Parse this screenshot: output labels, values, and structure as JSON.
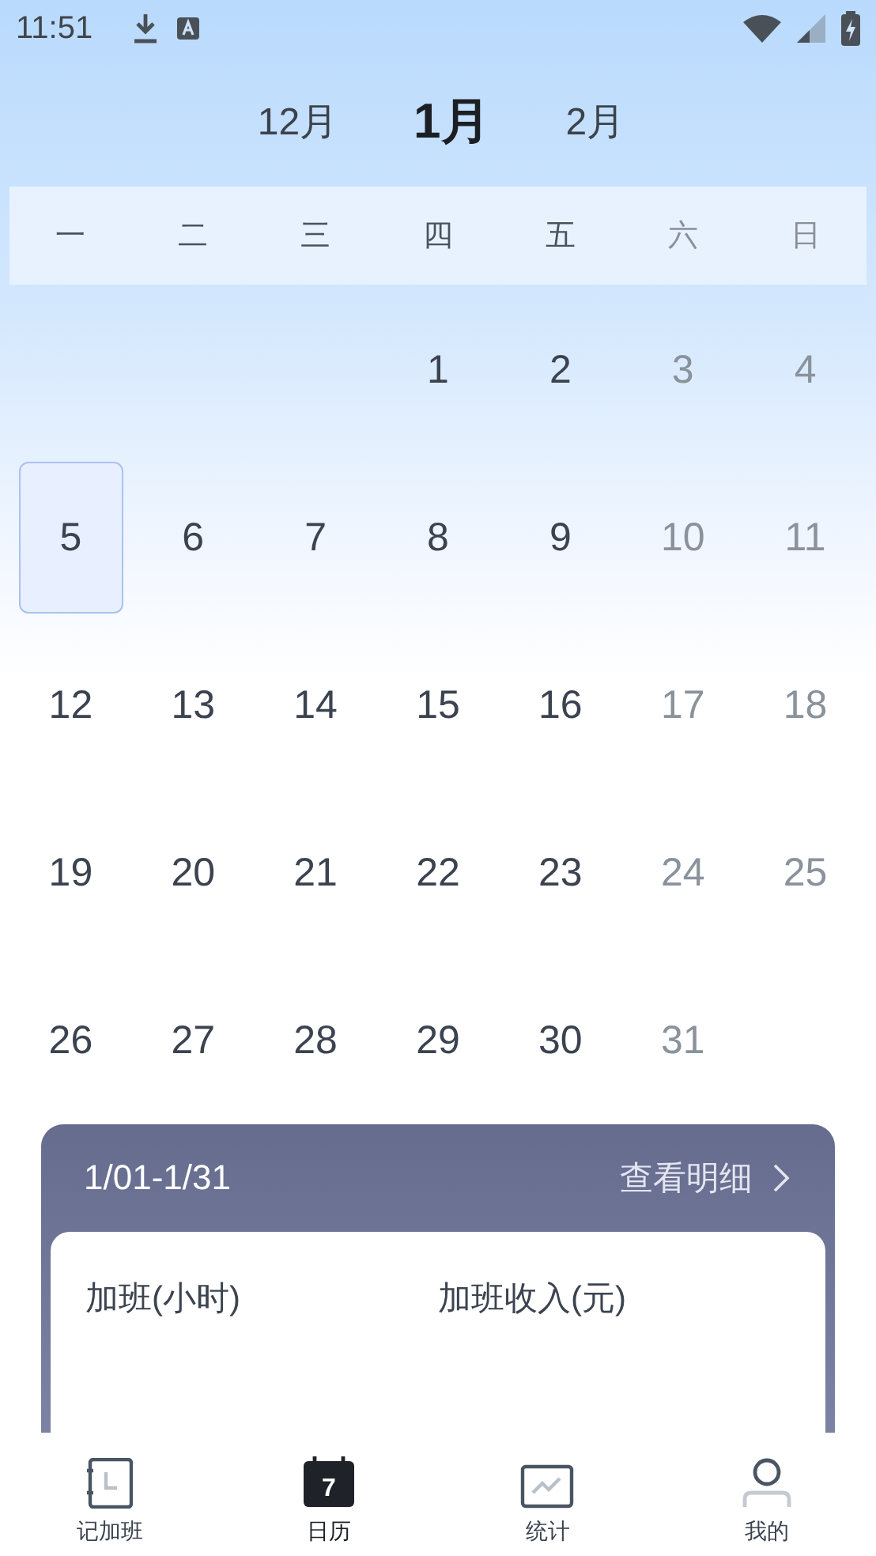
{
  "status_bar": {
    "time": "11:51"
  },
  "months": [
    {
      "label": "12月",
      "selected": false
    },
    {
      "label": "1月",
      "selected": true
    },
    {
      "label": "2月",
      "selected": false
    }
  ],
  "weekdays": [
    {
      "label": "一",
      "weekend": false
    },
    {
      "label": "二",
      "weekend": false
    },
    {
      "label": "三",
      "weekend": false
    },
    {
      "label": "四",
      "weekend": false
    },
    {
      "label": "五",
      "weekend": false
    },
    {
      "label": "六",
      "weekend": true
    },
    {
      "label": "日",
      "weekend": true
    }
  ],
  "weeks": [
    [
      {
        "kind": "blank"
      },
      {
        "kind": "blank"
      },
      {
        "kind": "blank"
      },
      {
        "kind": "day",
        "day": "1",
        "weekend": false,
        "selected": false
      },
      {
        "kind": "day",
        "day": "2",
        "weekend": false,
        "selected": false
      },
      {
        "kind": "day",
        "day": "3",
        "weekend": true,
        "selected": false
      },
      {
        "kind": "day",
        "day": "4",
        "weekend": true,
        "selected": false
      }
    ],
    [
      {
        "kind": "day",
        "day": "5",
        "weekend": false,
        "selected": true
      },
      {
        "kind": "day",
        "day": "6",
        "weekend": false,
        "selected": false
      },
      {
        "kind": "day",
        "day": "7",
        "weekend": false,
        "selected": false
      },
      {
        "kind": "day",
        "day": "8",
        "weekend": false,
        "selected": false
      },
      {
        "kind": "day",
        "day": "9",
        "weekend": false,
        "selected": false
      },
      {
        "kind": "day",
        "day": "10",
        "weekend": true,
        "selected": false
      },
      {
        "kind": "day",
        "day": "11",
        "weekend": true,
        "selected": false
      }
    ],
    [
      {
        "kind": "day",
        "day": "12",
        "weekend": false,
        "selected": false
      },
      {
        "kind": "day",
        "day": "13",
        "weekend": false,
        "selected": false
      },
      {
        "kind": "day",
        "day": "14",
        "weekend": false,
        "selected": false
      },
      {
        "kind": "day",
        "day": "15",
        "weekend": false,
        "selected": false
      },
      {
        "kind": "day",
        "day": "16",
        "weekend": false,
        "selected": false
      },
      {
        "kind": "day",
        "day": "17",
        "weekend": true,
        "selected": false
      },
      {
        "kind": "day",
        "day": "18",
        "weekend": true,
        "selected": false
      }
    ],
    [
      {
        "kind": "day",
        "day": "19",
        "weekend": false,
        "selected": false
      },
      {
        "kind": "day",
        "day": "20",
        "weekend": false,
        "selected": false
      },
      {
        "kind": "day",
        "day": "21",
        "weekend": false,
        "selected": false
      },
      {
        "kind": "day",
        "day": "22",
        "weekend": false,
        "selected": false
      },
      {
        "kind": "day",
        "day": "23",
        "weekend": false,
        "selected": false
      },
      {
        "kind": "day",
        "day": "24",
        "weekend": true,
        "selected": false
      },
      {
        "kind": "day",
        "day": "25",
        "weekend": true,
        "selected": false
      }
    ],
    [
      {
        "kind": "day",
        "day": "26",
        "weekend": false,
        "selected": false
      },
      {
        "kind": "day",
        "day": "27",
        "weekend": false,
        "selected": false
      },
      {
        "kind": "day",
        "day": "28",
        "weekend": false,
        "selected": false
      },
      {
        "kind": "day",
        "day": "29",
        "weekend": false,
        "selected": false
      },
      {
        "kind": "day",
        "day": "30",
        "weekend": false,
        "selected": false
      },
      {
        "kind": "day",
        "day": "31",
        "weekend": true,
        "selected": false
      },
      {
        "kind": "blank"
      }
    ]
  ],
  "summary": {
    "range": "1/01-1/31",
    "link": "查看明细",
    "stats": [
      {
        "label": "加班(小时)"
      },
      {
        "label": "加班收入(元)"
      }
    ]
  },
  "nav": [
    {
      "label": "记加班",
      "selected": false
    },
    {
      "label": "日历",
      "selected": true,
      "icon_text": "7"
    },
    {
      "label": "统计",
      "selected": false
    },
    {
      "label": "我的",
      "selected": false
    }
  ]
}
